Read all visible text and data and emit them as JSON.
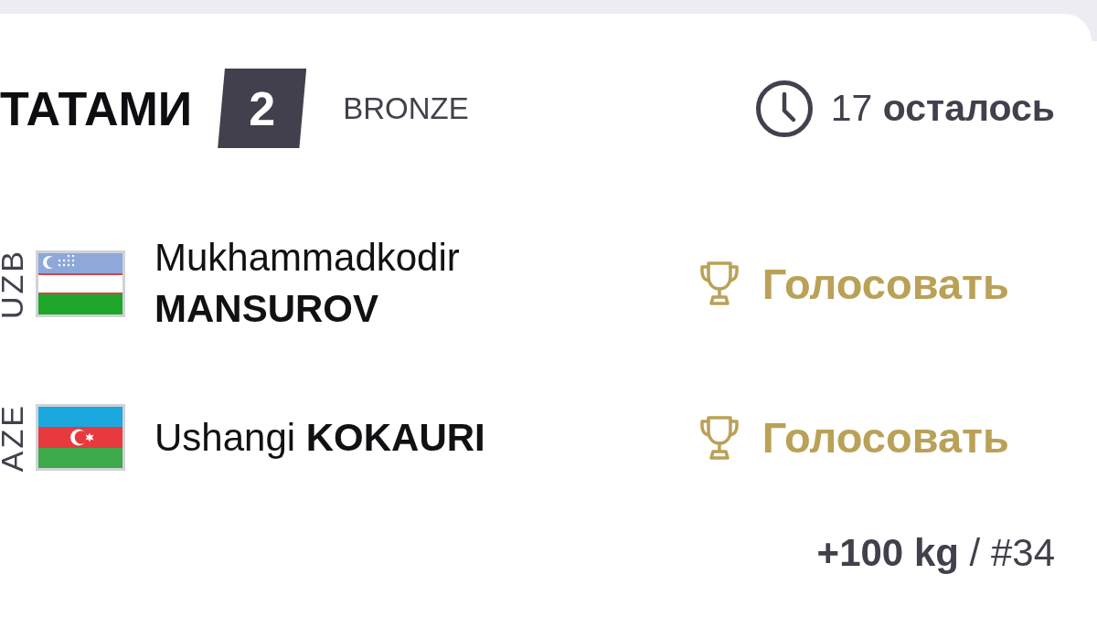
{
  "header": {
    "title": "ТАТАМИ",
    "tatami_number": "2",
    "stage": "BRONZE",
    "remaining": "17 **осталось**"
  },
  "athletes": [
    {
      "country": "UZB",
      "flag": {
        "kind": "uzbekistan"
      },
      "name": "Mukhammadkodir **MANSUROV**",
      "vote_button": {
        "label": "Голосовать"
      }
    },
    {
      "country": "AZE",
      "flag": {
        "kind": "azerbaijan"
      },
      "name": "Ushangi **KOKAURI**",
      "vote_button": {
        "label": "Голосовать"
      }
    }
  ],
  "footer": {
    "category": "**+100 kg** / #34"
  }
}
